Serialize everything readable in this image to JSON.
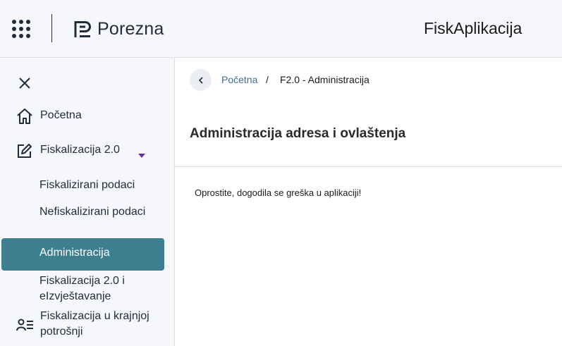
{
  "header": {
    "logo_text": "Porezna",
    "app_title": "FiskAplikacija"
  },
  "sidebar": {
    "items": [
      {
        "label": "Početna",
        "icon": "home-icon"
      },
      {
        "label": "Fiskalizacija 2.0",
        "icon": "edit-icon",
        "expanded": true
      }
    ],
    "subitems": [
      {
        "label": "Fiskalizirani podaci"
      },
      {
        "label": "Nefiskalizirani podaci"
      },
      {
        "label": "Administracija",
        "active": true
      },
      {
        "label": "Fiskalizacija 2.0 i eIzvještavanje"
      }
    ],
    "last_item": {
      "label": "Fiskalizacija u krajnjoj potrošnji",
      "icon": "user-list-icon"
    }
  },
  "breadcrumb": {
    "home": "Početna",
    "separator": "/",
    "current": "F2.0 - Administracija"
  },
  "main": {
    "title": "Administracija adresa i ovlaštenja",
    "error_message": "Oprostite, dogodila se greška u aplikaciji!"
  },
  "colors": {
    "accent": "#3d7f8e",
    "caret": "#6a2c91",
    "background": "#f6f7fa"
  }
}
